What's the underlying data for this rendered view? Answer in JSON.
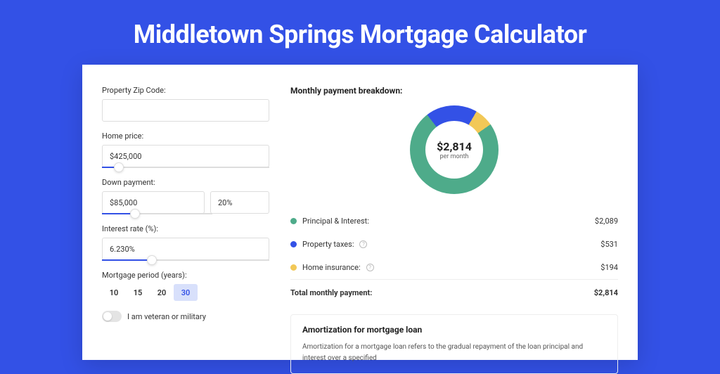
{
  "page": {
    "title": "Middletown Springs Mortgage Calculator"
  },
  "form": {
    "zip_label": "Property Zip Code:",
    "zip_value": "",
    "home_price_label": "Home price:",
    "home_price_value": "$425,000",
    "home_price_slider_pct": 10,
    "down_payment_label": "Down payment:",
    "down_payment_value": "$85,000",
    "down_payment_pct_value": "20%",
    "down_payment_slider_pct": 20,
    "interest_label": "Interest rate (%):",
    "interest_value": "6.230%",
    "interest_slider_pct": 30,
    "period_label": "Mortgage period (years):",
    "periods": [
      "10",
      "15",
      "20",
      "30"
    ],
    "period_selected": "30",
    "veteran_label": "I am veteran or military"
  },
  "breakdown": {
    "title": "Monthly payment breakdown:",
    "donut_amount": "$2,814",
    "donut_sub": "per month",
    "items": [
      {
        "label": "Principal & Interest:",
        "value": "$2,089",
        "color": "#4eab8a",
        "info": false
      },
      {
        "label": "Property taxes:",
        "value": "$531",
        "color": "#3351e6",
        "info": true
      },
      {
        "label": "Home insurance:",
        "value": "$194",
        "color": "#f2c857",
        "info": true
      }
    ],
    "total_label": "Total monthly payment:",
    "total_value": "$2,814"
  },
  "amortization": {
    "title": "Amortization for mortgage loan",
    "text": "Amortization for a mortgage loan refers to the gradual repayment of the loan principal and interest over a specified"
  },
  "chart_data": {
    "type": "pie",
    "title": "Monthly payment breakdown",
    "series": [
      {
        "name": "Principal & Interest",
        "value": 2089,
        "color": "#4eab8a"
      },
      {
        "name": "Property taxes",
        "value": 531,
        "color": "#3351e6"
      },
      {
        "name": "Home insurance",
        "value": 194,
        "color": "#f2c857"
      }
    ],
    "total": 2814,
    "center_label": "$2,814 per month"
  }
}
